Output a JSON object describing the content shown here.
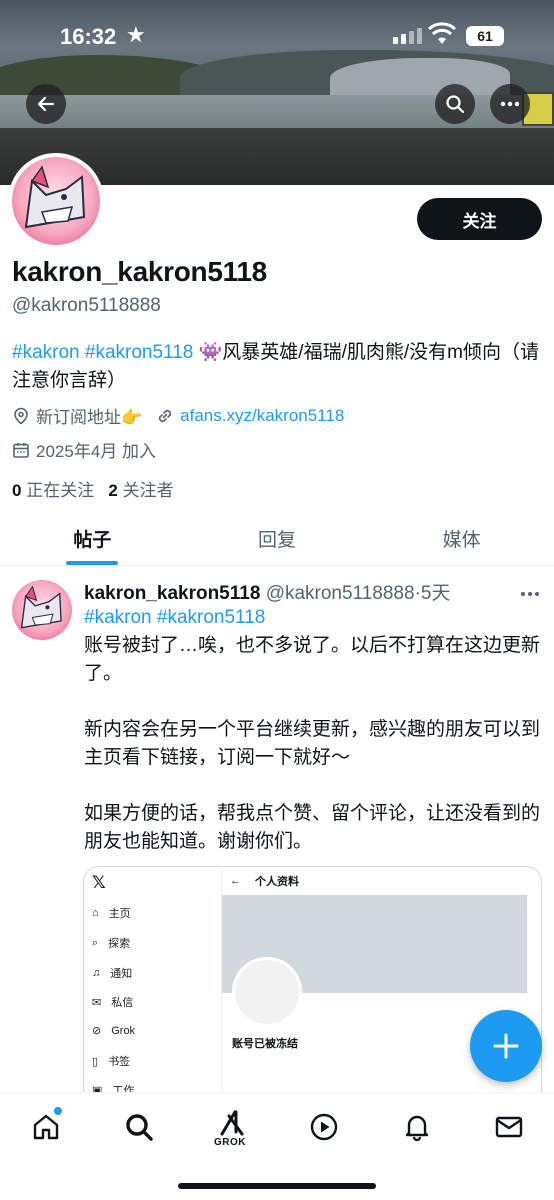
{
  "status_bar": {
    "time": "16:32",
    "battery": "61"
  },
  "header": {
    "back_icon": "arrow-left-icon",
    "search_icon": "search-icon",
    "more_icon": "ellipsis-icon"
  },
  "profile": {
    "follow_label": "关注",
    "display_name": "kakron_kakron5118",
    "handle": "@kakron5118888",
    "bio_hashtag1": "#kakron",
    "bio_hashtag2": "#kakron5118",
    "bio_emoji": "👾",
    "bio_text": "风暴英雄/福瑞/肌肉熊/没有m倾向（请注意你言辞）",
    "location": "新订阅地址👉",
    "website": "afans.xyz/kakron5118",
    "joined": "2025年4月 加入",
    "following_count": "0",
    "following_label": "正在关注",
    "followers_count": "2",
    "followers_label": "关注者"
  },
  "tabs": [
    {
      "label": "帖子",
      "active": true
    },
    {
      "label": "回复",
      "active": false
    },
    {
      "label": "媒体",
      "active": false
    }
  ],
  "post": {
    "author_name": "kakron_kakron5118",
    "author_handle": "@kakron5118888",
    "separator": "·",
    "time": "5天",
    "hashtags": "#kakron #kakron5118",
    "paragraphs": [
      "账号被封了…唉，也不多说了。以后不打算在这边更新了。",
      "新内容会在另一个平台继续更新，感兴趣的朋友可以到主页看下链接，订阅一下就好～",
      "如果方便的话，帮我点个赞、留个评论，让还没看到的朋友也能知道。谢谢你们。"
    ],
    "media": {
      "logo": "𝕏",
      "nav_items": [
        "主页",
        "探索",
        "通知",
        "私信",
        "Grok",
        "书签",
        "工作"
      ],
      "page_title": "个人资料",
      "frozen_text": "账号已被冻结"
    }
  },
  "bottom_nav": {
    "grok_label": "GROK"
  },
  "colors": {
    "accent": "#1d9bf0",
    "text": "#0f1419",
    "secondary": "#536471"
  }
}
